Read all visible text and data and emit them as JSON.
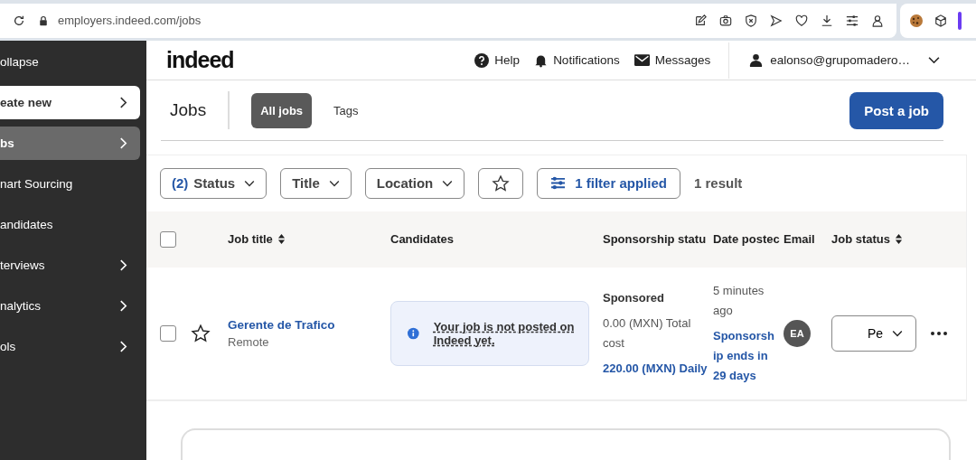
{
  "browser": {
    "url": "employers.indeed.com/jobs"
  },
  "sidebar": {
    "items": [
      {
        "label": "ollapse",
        "kind": "plain",
        "selected": false,
        "expandable": false
      },
      {
        "label": "eate new",
        "kind": "action",
        "selected": false,
        "expandable": true
      },
      {
        "label": "bs",
        "kind": "plain",
        "selected": true,
        "expandable": true
      },
      {
        "label": "nart Sourcing",
        "kind": "plain",
        "selected": false,
        "expandable": false
      },
      {
        "label": "andidates",
        "kind": "plain",
        "selected": false,
        "expandable": false
      },
      {
        "label": "terviews",
        "kind": "plain",
        "selected": false,
        "expandable": true
      },
      {
        "label": "nalytics",
        "kind": "plain",
        "selected": false,
        "expandable": true
      },
      {
        "label": "ols",
        "kind": "plain",
        "selected": false,
        "expandable": true
      }
    ]
  },
  "header": {
    "logo": "indeed",
    "links": [
      {
        "kind": "help",
        "label": "Help"
      },
      {
        "kind": "notifications",
        "label": "Notifications"
      },
      {
        "kind": "messages",
        "label": "Messages"
      }
    ],
    "account": "ealonso@grupomadero…"
  },
  "page": {
    "title": "Jobs",
    "tabs": [
      {
        "label": "All jobs",
        "selected": true
      },
      {
        "label": "Tags",
        "selected": false
      }
    ],
    "post_button": "Post a job"
  },
  "filters": {
    "dropdowns": [
      {
        "count": "(2)",
        "label": "Status"
      },
      {
        "label": "Title"
      },
      {
        "label": "Location"
      }
    ],
    "applied": "1 filter applied",
    "results": "1 result"
  },
  "table": {
    "select_all_checked": false,
    "columns": [
      {
        "label": "Job title",
        "sortable": true
      },
      {
        "label": "Candidates"
      },
      {
        "label": "Sponsorship statu"
      },
      {
        "label": "Date postec"
      },
      {
        "label": "Email"
      },
      {
        "label": "Job status",
        "sortable": true
      }
    ],
    "rows": [
      {
        "checked": false,
        "starred": false,
        "title": "Gerente de Trafico",
        "location": "Remote",
        "notice": "Your job is not posted on Indeed yet.",
        "sponsorship": "Sponsored",
        "cost": "0.00 (MXN) Total cost",
        "budget": "220.00 (MXN) Daily",
        "date": "5 minutes ago",
        "sponsor_end": "Sponsorship ends in 29 days",
        "email_initials": "EA",
        "job_status": "Pe"
      }
    ]
  }
}
